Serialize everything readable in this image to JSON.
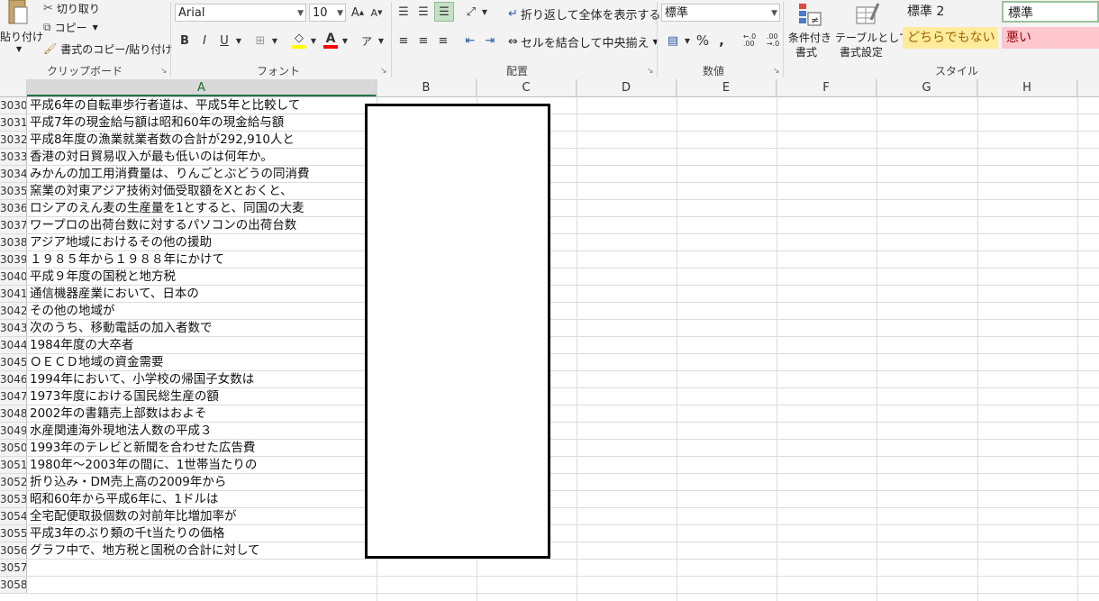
{
  "clipboard": {
    "paste_label": "貼り付け",
    "cut_label": "切り取り",
    "copy_label": "コピー",
    "format_painter_label": "書式のコピー/貼り付け",
    "group_title": "クリップボード"
  },
  "font": {
    "font_name": "Arial",
    "font_size": "10",
    "bold": "B",
    "italic": "I",
    "underline": "U",
    "font_color_glyph": "A",
    "group_title": "フォント"
  },
  "alignment": {
    "wrap_text_label": "折り返して全体を表示する",
    "merge_center_label": "セルを結合して中央揃え",
    "group_title": "配置"
  },
  "number": {
    "format_value": "標準",
    "percent": "%",
    "comma": ",",
    "inc_decimal": ".0\n.00",
    "dec_decimal": ".00\n.0",
    "group_title": "数値"
  },
  "styles": {
    "conditional_label_1": "条件付き",
    "conditional_label_2": "書式",
    "table_label_1": "テーブルとして",
    "table_label_2": "書式設定",
    "style_standard2": "標準 2",
    "style_standard": "標準",
    "style_neutral": "どちらでもない",
    "style_bad": "悪い",
    "group_title": "スタイル",
    "neutral_bg": "#ffeb9c",
    "neutral_fg": "#9c6500",
    "bad_bg": "#ffc7ce",
    "bad_fg": "#9c0006"
  },
  "columns": [
    "A",
    "B",
    "C",
    "D",
    "E",
    "F",
    "G",
    "H"
  ],
  "rows": [
    {
      "num": "3030",
      "a": "平成6年の自転車歩行者道は、平成5年と比較して"
    },
    {
      "num": "3031",
      "a": "平成7年の現金給与額は昭和60年の現金給与額"
    },
    {
      "num": "3032",
      "a": "平成8年度の漁業就業者数の合計が292,910人と"
    },
    {
      "num": "3033",
      "a": "香港の対日貿易収入が最も低いのは何年か。"
    },
    {
      "num": "3034",
      "a": "みかんの加工用消費量は、りんごとぶどうの同消費"
    },
    {
      "num": "3035",
      "a": "窯業の対東アジア技術対価受取額をXとおくと、"
    },
    {
      "num": "3036",
      "a": "ロシアのえん麦の生産量を1とすると、同国の大麦"
    },
    {
      "num": "3037",
      "a": "ワープロの出荷台数に対するパソコンの出荷台数"
    },
    {
      "num": "3038",
      "a": "アジア地域におけるその他の援助"
    },
    {
      "num": "3039",
      "a": "１９８５年から１９８８年にかけて"
    },
    {
      "num": "3040",
      "a": "平成９年度の国税と地方税"
    },
    {
      "num": "3041",
      "a": "通信機器産業において、日本の"
    },
    {
      "num": "3042",
      "a": "その他の地域が"
    },
    {
      "num": "3043",
      "a": "次のうち、移動電話の加入者数で"
    },
    {
      "num": "3044",
      "a": "1984年度の大卒者"
    },
    {
      "num": "3045",
      "a": "ＯＥＣＤ地域の資金需要"
    },
    {
      "num": "3046",
      "a": "1994年において、小学校の帰国子女数は"
    },
    {
      "num": "3047",
      "a": "1973年度における国民総生産の額"
    },
    {
      "num": "3048",
      "a": "2002年の書籍売上部数はおよそ"
    },
    {
      "num": "3049",
      "a": "水産関連海外現地法人数の平成３"
    },
    {
      "num": "3050",
      "a": "1993年のテレビと新聞を合わせた広告費"
    },
    {
      "num": "3051",
      "a": "1980年～2003年の間に、1世帯当たりの"
    },
    {
      "num": "3052",
      "a": "折り込み・DM売上高の2009年から"
    },
    {
      "num": "3053",
      "a": "昭和60年から平成6年に、1ドルは"
    },
    {
      "num": "3054",
      "a": "全宅配便取扱個数の対前年比増加率が"
    },
    {
      "num": "3055",
      "a": "平成3年のぶり類の千t当たりの価格"
    },
    {
      "num": "3056",
      "a": "グラフ中で、地方税と国税の合計に対して"
    },
    {
      "num": "3057",
      "a": ""
    },
    {
      "num": "3058",
      "a": ""
    }
  ]
}
